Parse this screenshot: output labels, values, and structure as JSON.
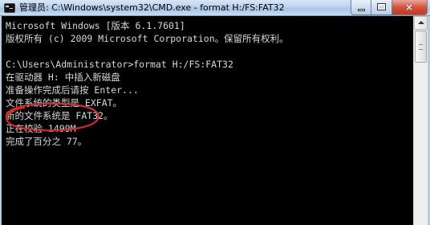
{
  "window": {
    "title": "管理员: C:\\Windows\\system32\\CMD.exe - format  H:/FS:FAT32",
    "icon": "cmd-icon",
    "controls": {
      "minimize": "minimize-icon",
      "maximize": "maximize-icon",
      "close": "×"
    }
  },
  "console": {
    "lines": [
      "Microsoft Windows [版本 6.1.7601]",
      "版权所有 (c) 2009 Microsoft Corporation。保留所有权利。",
      "",
      "C:\\Users\\Administrator>format H:/FS:FAT32",
      "在驱动器 H: 中插入新磁盘",
      "准备操作完成后请按 Enter...",
      "文件系统的类型是 EXFAT。",
      "新的文件系统是 FAT32。",
      "正在校验 1499M",
      "完成了百分之 77。"
    ]
  },
  "colors": {
    "console_background": "#000000",
    "console_text": "#d8d8d8",
    "annotation": "#d32a2a",
    "close_button": "#c13a22"
  }
}
